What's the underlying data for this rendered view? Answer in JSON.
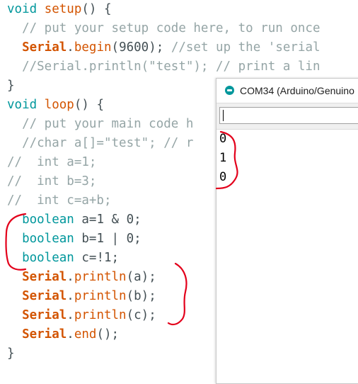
{
  "code": {
    "l1": {
      "kw": "void",
      "fn": "setup",
      "rest": "() {"
    },
    "l2": "  // put your setup code here, to run once",
    "l3": {
      "indent": "  ",
      "obj": "Serial",
      "dot": ".",
      "fn": "begin",
      "rest": "(9600); ",
      "cm": "//set up the 'serial"
    },
    "l4": "  //Serial.println(\"test\"); // print a lin",
    "l5": "}",
    "l6": {
      "kw": "void",
      "fn": "loop",
      "rest": "() {"
    },
    "l7": "  // put your main code h",
    "l8": "  //char a[]=\"test\"; // r",
    "l9": "//  int a=1;",
    "l10": "//  int b=3;",
    "l11": "//  int c=a+b;",
    "l12": {
      "indent": "  ",
      "kw": "boolean",
      "rest": " a=1 & 0;"
    },
    "l13": {
      "indent": "  ",
      "kw": "boolean",
      "rest": " b=1 | 0;"
    },
    "l14": {
      "indent": "  ",
      "kw": "boolean",
      "rest": " c=!1;"
    },
    "l15": {
      "indent": "  ",
      "obj": "Serial",
      "dot": ".",
      "fn": "println",
      "rest": "(a);"
    },
    "l16": {
      "indent": "  ",
      "obj": "Serial",
      "dot": ".",
      "fn": "println",
      "rest": "(b);"
    },
    "l17": {
      "indent": "  ",
      "obj": "Serial",
      "dot": ".",
      "fn": "println",
      "rest": "(c);"
    },
    "l18": {
      "indent": "  ",
      "obj": "Serial",
      "dot": ".",
      "fn": "end",
      "rest": "();"
    },
    "l19": "}"
  },
  "serial_monitor": {
    "title": "COM34 (Arduino/Genuino",
    "output": [
      "0",
      "1",
      "0"
    ]
  },
  "colors": {
    "keyword": "#00979c",
    "function": "#d35400",
    "comment": "#95a5a6",
    "annotation": "#e3001b"
  }
}
